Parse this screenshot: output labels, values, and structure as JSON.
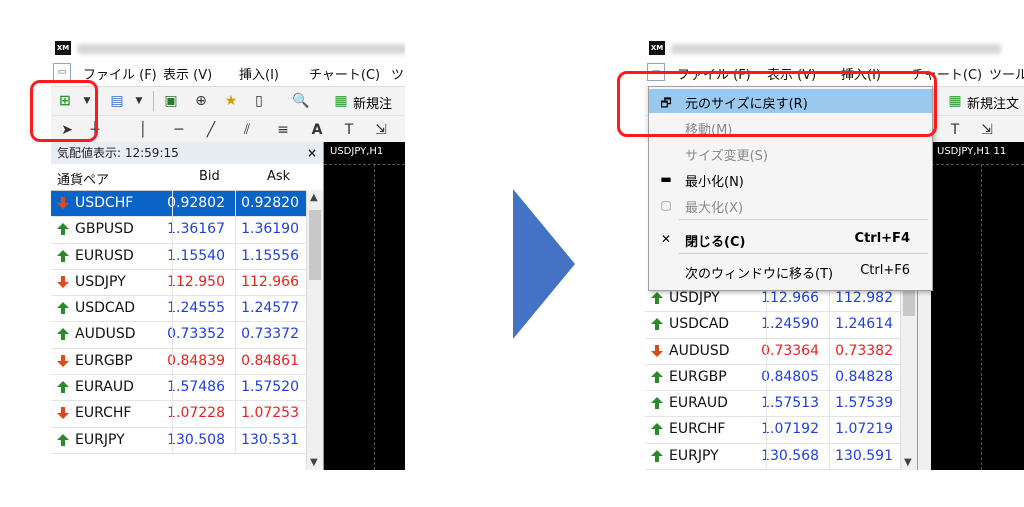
{
  "window": {
    "logo": "XM"
  },
  "menubar": [
    "ファイル (F)",
    "表示 (V)",
    "挿入(I)",
    "チャート(C)",
    "ツ"
  ],
  "menubar_right": [
    "ファイル (F)",
    "表示 (V)",
    "挿入(I)",
    "チャート(C)",
    "ツール"
  ],
  "toolbar": {
    "new_order_label": "新規注",
    "new_order_label_right": "新規注文",
    "text_tool": "A"
  },
  "market_watch": {
    "header": "気配値表示: 12:59:15",
    "close": "×",
    "columns": {
      "symbol": "通貨ペア",
      "bid": "Bid",
      "ask": "Ask"
    },
    "rows": [
      {
        "symbol": "USDCHF",
        "bid": "0.92802",
        "ask": "0.92820",
        "dir": "down",
        "selected": true
      },
      {
        "symbol": "GBPUSD",
        "bid": "1.36167",
        "ask": "1.36190",
        "dir": "up"
      },
      {
        "symbol": "EURUSD",
        "bid": "1.15540",
        "ask": "1.15556",
        "dir": "up"
      },
      {
        "symbol": "USDJPY",
        "bid": "112.950",
        "ask": "112.966",
        "dir": "down"
      },
      {
        "symbol": "USDCAD",
        "bid": "1.24555",
        "ask": "1.24577",
        "dir": "up"
      },
      {
        "symbol": "AUDUSD",
        "bid": "0.73352",
        "ask": "0.73372",
        "dir": "up"
      },
      {
        "symbol": "EURGBP",
        "bid": "0.84839",
        "ask": "0.84861",
        "dir": "down"
      },
      {
        "symbol": "EURAUD",
        "bid": "1.57486",
        "ask": "1.57520",
        "dir": "up"
      },
      {
        "symbol": "EURCHF",
        "bid": "1.07228",
        "ask": "1.07253",
        "dir": "down"
      },
      {
        "symbol": "EURJPY",
        "bid": "130.508",
        "ask": "130.531",
        "dir": "up"
      }
    ]
  },
  "market_watch_right": {
    "rows": [
      {
        "symbol": "USDJPY",
        "bid": "112.966",
        "ask": "112.982",
        "dir": "up"
      },
      {
        "symbol": "USDCAD",
        "bid": "1.24590",
        "ask": "1.24614",
        "dir": "up"
      },
      {
        "symbol": "AUDUSD",
        "bid": "0.73364",
        "ask": "0.73382",
        "dir": "down"
      },
      {
        "symbol": "EURGBP",
        "bid": "0.84805",
        "ask": "0.84828",
        "dir": "up"
      },
      {
        "symbol": "EURAUD",
        "bid": "1.57513",
        "ask": "1.57539",
        "dir": "up"
      },
      {
        "symbol": "EURCHF",
        "bid": "1.07192",
        "ask": "1.07219",
        "dir": "up"
      },
      {
        "symbol": "EURJPY",
        "bid": "130.568",
        "ask": "130.591",
        "dir": "up"
      }
    ]
  },
  "chart": {
    "label_left": "USDJPY,H1",
    "label_right": "USDJPY,H1  11"
  },
  "context_menu": [
    {
      "icon": "restore-icon",
      "glyph": "🗗",
      "label": "元のサイズに戻す(R)",
      "shortcut": "",
      "state": "highlighted"
    },
    {
      "icon": "",
      "glyph": "",
      "label": "移動(M)",
      "shortcut": "",
      "state": "disabled"
    },
    {
      "icon": "",
      "glyph": "",
      "label": "サイズ変更(S)",
      "shortcut": "",
      "state": "disabled"
    },
    {
      "icon": "minimize-icon",
      "glyph": "▬",
      "label": "最小化(N)",
      "shortcut": "",
      "state": "normal"
    },
    {
      "icon": "maximize-icon",
      "glyph": "▢",
      "label": "最大化(X)",
      "shortcut": "",
      "state": "disabled"
    },
    {
      "icon": "close-icon",
      "glyph": "✕",
      "label": "閉じる(C)",
      "shortcut": "Ctrl+F4",
      "state": "bold"
    },
    {
      "icon": "",
      "glyph": "",
      "label": "次のウィンドウに移る(T)",
      "shortcut": "Ctrl+F6",
      "state": "normal"
    }
  ],
  "colors": {
    "up": "#2c8a2c",
    "down": "#e04a1a",
    "bid_blue": "#1f3fe0",
    "bid_red": "#e52222",
    "highlight": "#ff1a1a",
    "arrow": "#4472c4"
  }
}
